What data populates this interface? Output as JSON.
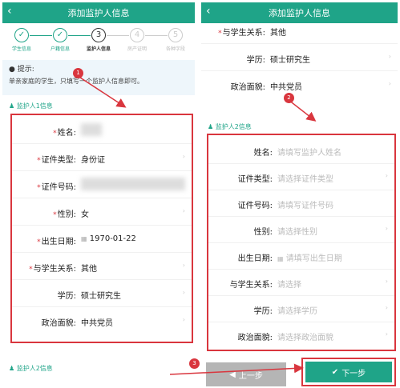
{
  "header": {
    "title": "添加监护人信息",
    "back": "‹"
  },
  "steps": [
    {
      "num": "✓",
      "label": "学生信息"
    },
    {
      "num": "✓",
      "label": "户籍信息"
    },
    {
      "num": "3",
      "label": "监护人信息"
    },
    {
      "num": "4",
      "label": "房产证明"
    },
    {
      "num": "5",
      "label": "各种字段"
    }
  ],
  "tip": {
    "title": "提示:",
    "text": "单亲家庭的学生，只填写一个监护人信息即可。"
  },
  "guardian1": {
    "title": "监护人1信息",
    "fields": [
      {
        "label": "姓名:",
        "value": ""
      },
      {
        "label": "证件类型:",
        "value": "身份证"
      },
      {
        "label": "证件号码:",
        "value": ""
      },
      {
        "label": "性别:",
        "value": "女"
      },
      {
        "label": "出生日期:",
        "value": "1970-01-22"
      },
      {
        "label": "与学生关系:",
        "value": "其他"
      },
      {
        "label": "学历:",
        "value": "硕士研究生"
      },
      {
        "label": "政治面貌:",
        "value": "中共党员"
      }
    ]
  },
  "guardian2_title_left": "监护人2信息",
  "right_top": [
    {
      "label": "与学生关系:",
      "value": "其他"
    },
    {
      "label": "学历:",
      "value": "硕士研究生"
    },
    {
      "label": "政治面貌:",
      "value": "中共党员"
    }
  ],
  "guardian2": {
    "title": "监护人2信息",
    "fields": [
      {
        "label": "姓名:",
        "placeholder": "请填写监护人姓名"
      },
      {
        "label": "证件类型:",
        "placeholder": "请选择证件类型"
      },
      {
        "label": "证件号码:",
        "placeholder": "请填写证件号码"
      },
      {
        "label": "性别:",
        "placeholder": "请选择性别"
      },
      {
        "label": "出生日期:",
        "placeholder": "请填写出生日期"
      },
      {
        "label": "与学生关系:",
        "placeholder": "请选择"
      },
      {
        "label": "学历:",
        "placeholder": "请选择学历"
      },
      {
        "label": "政治面貌:",
        "placeholder": "请选择政治面貌"
      }
    ]
  },
  "buttons": {
    "prev": "上一步",
    "next": "下一步"
  },
  "markers": [
    "1",
    "2",
    "3"
  ],
  "colors": {
    "brand": "#1fa488",
    "highlight": "#d9363e"
  }
}
